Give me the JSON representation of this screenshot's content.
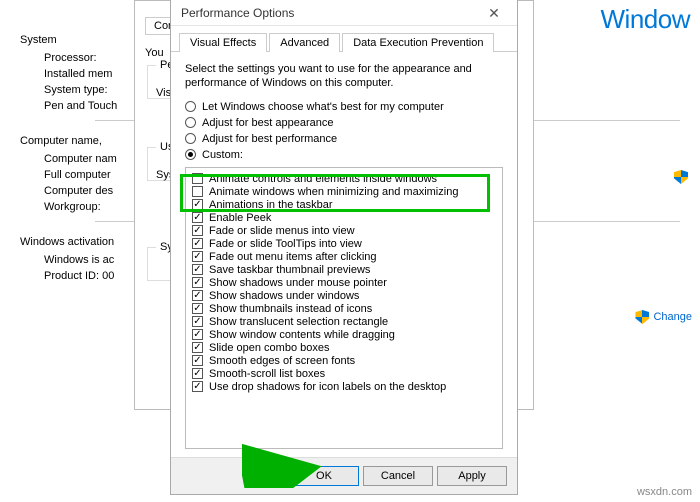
{
  "brand": "Window",
  "bg": {
    "system": "System",
    "processor": "Processor:",
    "installed_mem": "Installed mem",
    "system_type": "System type:",
    "pen_touch": "Pen and Touch",
    "computer_name": "Computer name,",
    "computer_nam": "Computer nam",
    "full_computer": "Full computer",
    "computer_des": "Computer des",
    "workgroup": "Workgroup:",
    "activation": "Windows activation",
    "windows_is": "Windows is ac",
    "product_id": "Product ID:  00"
  },
  "mid": {
    "tab1": "Compu",
    "line1": "You",
    "group1": "Per",
    "group1_line": "Vis",
    "group2": "Use",
    "group2_line": "Sys",
    "group3": "Sys"
  },
  "shield_link1": "",
  "shield_link2": "Change",
  "perf": {
    "title": "Performance Options",
    "tabs": {
      "visual": "Visual Effects",
      "advanced": "Advanced",
      "dep": "Data Execution Prevention"
    },
    "desc": "Select the settings you want to use for the appearance and performance of Windows on this computer.",
    "radios": {
      "r1": "Let Windows choose what's best for my computer",
      "r2": "Adjust for best appearance",
      "r3": "Adjust for best performance",
      "r4": "Custom:"
    },
    "checks": [
      {
        "label": "Animate controls and elements inside windows",
        "checked": false
      },
      {
        "label": "Animate windows when minimizing and maximizing",
        "checked": false
      },
      {
        "label": "Animations in the taskbar",
        "checked": true
      },
      {
        "label": "Enable Peek",
        "checked": true
      },
      {
        "label": "Fade or slide menus into view",
        "checked": true
      },
      {
        "label": "Fade or slide ToolTips into view",
        "checked": true
      },
      {
        "label": "Fade out menu items after clicking",
        "checked": true
      },
      {
        "label": "Save taskbar thumbnail previews",
        "checked": true
      },
      {
        "label": "Show shadows under mouse pointer",
        "checked": true
      },
      {
        "label": "Show shadows under windows",
        "checked": true
      },
      {
        "label": "Show thumbnails instead of icons",
        "checked": true
      },
      {
        "label": "Show translucent selection rectangle",
        "checked": true
      },
      {
        "label": "Show window contents while dragging",
        "checked": true
      },
      {
        "label": "Slide open combo boxes",
        "checked": true
      },
      {
        "label": "Smooth edges of screen fonts",
        "checked": true
      },
      {
        "label": "Smooth-scroll list boxes",
        "checked": true
      },
      {
        "label": "Use drop shadows for icon labels on the desktop",
        "checked": true
      }
    ],
    "buttons": {
      "ok": "OK",
      "cancel": "Cancel",
      "apply": "Apply"
    }
  },
  "watermark": "wsxdn.com"
}
